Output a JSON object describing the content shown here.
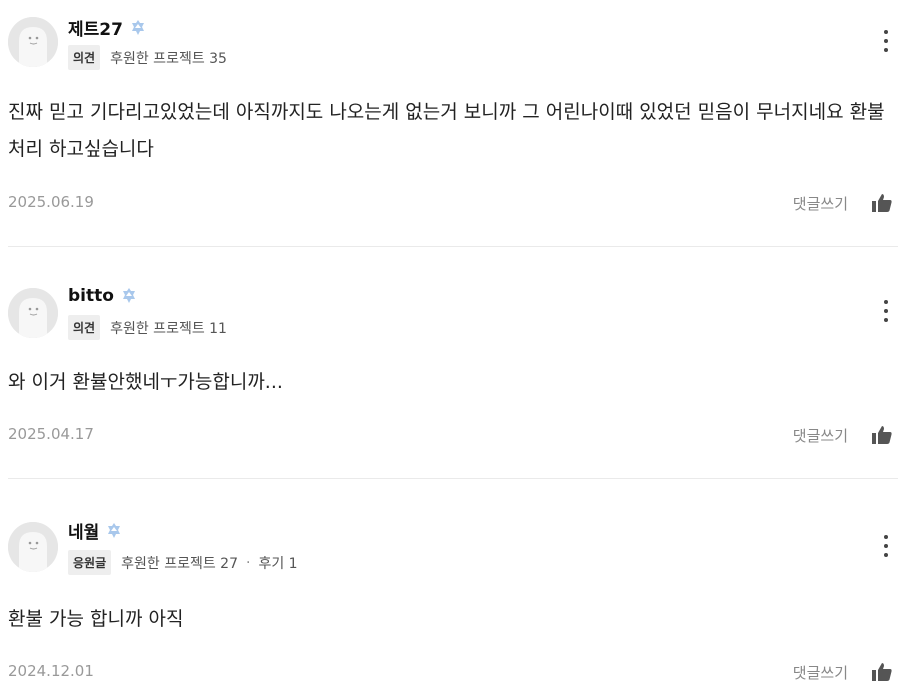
{
  "comments": [
    {
      "name": "제트27",
      "tag": "의견",
      "projects": "후원한 프로젝트 35",
      "reviews": "",
      "body": "진짜 믿고 기다리고있었는데 아직까지도 나오는게 없는거 보니까 그 어린나이때 있었던 믿음이 무너지네요 환불처리 하고싶습니다",
      "date": "2025.06.19",
      "reply_label": "댓글쓰기"
    },
    {
      "name": "bitto",
      "tag": "의견",
      "projects": "후원한 프로젝트 11",
      "reviews": "",
      "body": "와 이거 환뷸안했네ㅜ가능합니까...",
      "date": "2025.04.17",
      "reply_label": "댓글쓰기"
    },
    {
      "name": "네월",
      "tag": "응원글",
      "projects": "후원한 프로젝트 27",
      "reviews": "후기 1",
      "body": "환불 가능 합니까 아직",
      "date": "2024.12.01",
      "reply_label": "댓글쓰기"
    }
  ],
  "icons": {
    "avatar": "default-avatar-icon",
    "badge": "supporter-badge-icon",
    "more": "more-vertical-icon",
    "like": "thumbs-up-icon"
  },
  "colors": {
    "badge": "#a9c8ec",
    "avatar_bg": "#e6e6e6",
    "like_icon": "#555555"
  }
}
